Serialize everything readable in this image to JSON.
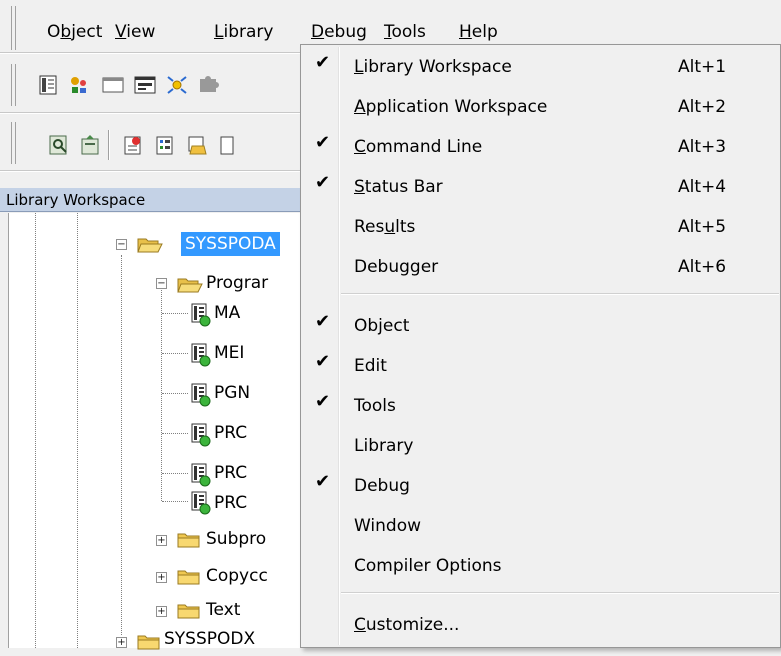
{
  "menubar": {
    "items": [
      {
        "label": "Object",
        "key": "b"
      },
      {
        "label": "View",
        "key": "V"
      },
      {
        "label": "Library",
        "key": "L"
      },
      {
        "label": "Debug",
        "key": "D"
      },
      {
        "label": "Tools",
        "key": "T"
      },
      {
        "label": "Help",
        "key": "H"
      }
    ]
  },
  "workspace": {
    "header": "Library Workspace",
    "tree": [
      {
        "label": "SYSSPODA",
        "selected": true
      },
      {
        "label": "Prograr"
      },
      {
        "label": "MA"
      },
      {
        "label": "MEI"
      },
      {
        "label": "PGN"
      },
      {
        "label": "PRC"
      },
      {
        "label": "PRC"
      },
      {
        "label": "PRC"
      },
      {
        "label": "Subpro"
      },
      {
        "label": "Copycc"
      },
      {
        "label": "Text"
      },
      {
        "label": "SYSSPODX"
      }
    ]
  },
  "dropdown": {
    "items": [
      {
        "label": "Library Workspace",
        "shortcut": "Alt+1",
        "checked": true
      },
      {
        "label": "Application Workspace",
        "shortcut": "Alt+2",
        "checked": false
      },
      {
        "label": "Command Line",
        "shortcut": "Alt+3",
        "checked": true
      },
      {
        "label": "Status Bar",
        "shortcut": "Alt+4",
        "checked": true
      },
      {
        "label": "Results",
        "shortcut": "Alt+5",
        "checked": false
      },
      {
        "label": "Debugger",
        "shortcut": "Alt+6",
        "checked": false
      },
      {
        "label": "Object",
        "checked": true
      },
      {
        "label": "Edit",
        "checked": true
      },
      {
        "label": "Tools",
        "checked": true
      },
      {
        "label": "Library",
        "checked": false
      },
      {
        "label": "Debug",
        "checked": true
      },
      {
        "label": "Window",
        "checked": false
      },
      {
        "label": "Compiler Options",
        "checked": false
      },
      {
        "label": "Customize...",
        "checked": false
      }
    ]
  },
  "colors": {
    "selection": "#3399ff",
    "panel_header": "#c4d2e6",
    "menu_bg": "#f0f0f0"
  }
}
